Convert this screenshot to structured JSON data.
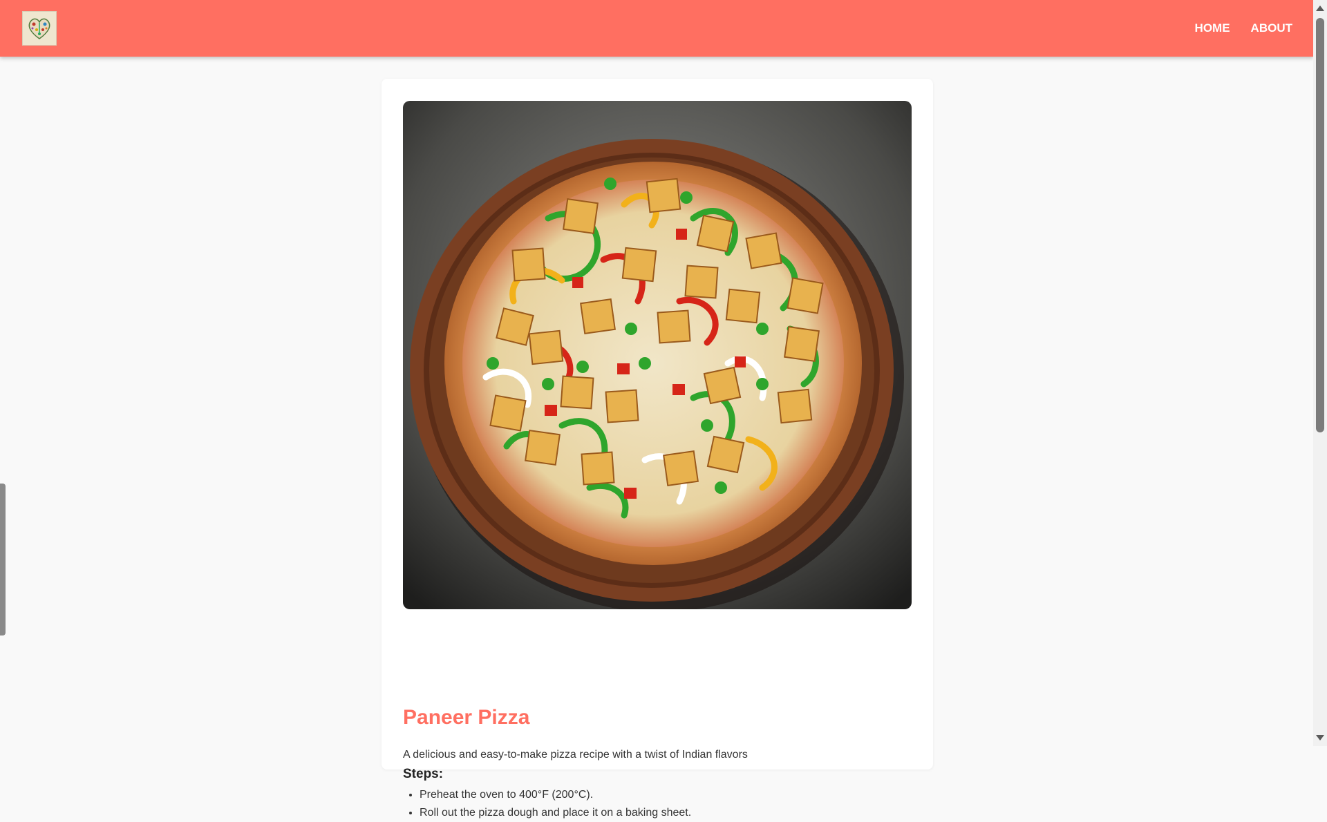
{
  "nav": {
    "logo_icon": "heart-floral-logo-icon",
    "links": [
      {
        "label": "HOME"
      },
      {
        "label": "ABOUT"
      }
    ],
    "color": "#ff6f61"
  },
  "recipe": {
    "image_icon": "paneer-pizza-image",
    "title": "Paneer Pizza",
    "description": "A delicious and easy-to-make pizza recipe with a twist of Indian flavors",
    "steps_heading": "Steps:",
    "steps": [
      "Preheat the oven to 400°F (200°C).",
      "Roll out the pizza dough and place it on a baking sheet."
    ]
  }
}
